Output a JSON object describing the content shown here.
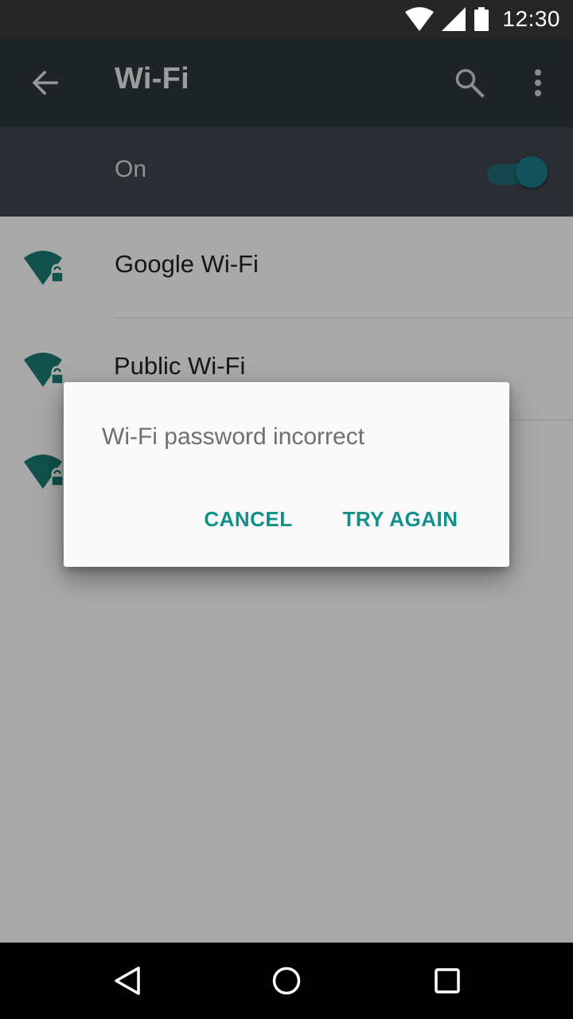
{
  "status_bar": {
    "time": "12:30",
    "icons": [
      "wifi-signal-icon",
      "cell-signal-icon",
      "battery-icon"
    ]
  },
  "app_bar": {
    "title": "Wi-Fi",
    "icons": [
      "arrow-back-icon",
      "search-icon",
      "more-vert-icon"
    ]
  },
  "wifi_switch": {
    "label": "On",
    "state": "on"
  },
  "networks": [
    {
      "name": "Google Wi-Fi",
      "secured": true
    },
    {
      "name": "Public  Wi-Fi",
      "secured": true
    },
    {
      "name": "",
      "secured": true
    }
  ],
  "dialog": {
    "message": "Wi-Fi password incorrect",
    "cancel_label": "CANCEL",
    "retry_label": "TRY AGAIN"
  },
  "nav_bar": {
    "icons": [
      "nav-back-icon",
      "nav-home-icon",
      "nav-recents-icon"
    ]
  },
  "colors": {
    "accent": "#11908a",
    "status_bar": "#262626",
    "app_bar": "#2f3538",
    "switch_bar": "#3e454d",
    "wifi_icon": "#1a7a72"
  }
}
